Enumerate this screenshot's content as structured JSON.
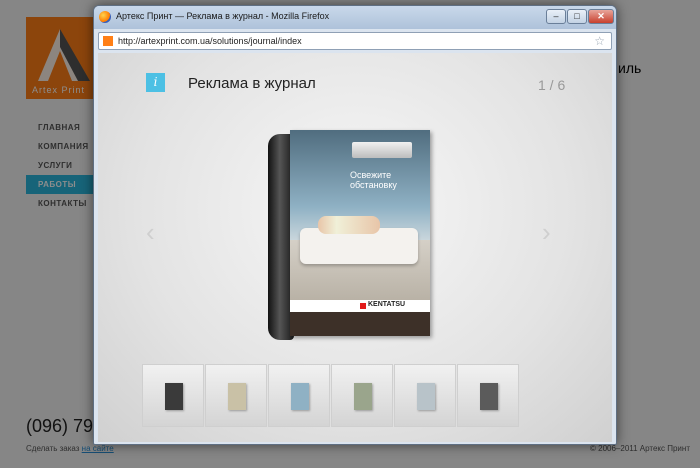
{
  "background_page": {
    "logo_text": "Artex Print",
    "heading_tail": "иль",
    "nav": [
      {
        "label": "ГЛАВНАЯ",
        "active": false
      },
      {
        "label": "КОМПАНИЯ",
        "active": false
      },
      {
        "label": "УСЛУГИ",
        "active": false
      },
      {
        "label": "РАБОТЫ",
        "active": true
      },
      {
        "label": "КОНТАКТЫ",
        "active": false
      }
    ],
    "phone": "(096) 79",
    "order_prefix": "Сделать заказ ",
    "order_link": "на сайте",
    "copyright": "© 2006–2011 Артекс Принт"
  },
  "browser": {
    "title": "Артекс Принт — Реклама в журнал - Mozilla Firefox",
    "url": "http://artexprint.com.ua/solutions/journal/index",
    "min_glyph": "–",
    "max_glyph": "□",
    "close_glyph": "✕",
    "star_glyph": "☆"
  },
  "gallery": {
    "info_glyph": "i",
    "title": "Реклама в журнал",
    "counter": "1 / 6",
    "prev_glyph": "‹",
    "next_glyph": "›",
    "ad_headline_1": "Освежите",
    "ad_headline_2": "обстановку",
    "ad_brand": "KENTATSU",
    "thumb_colors": [
      "#3a3a3a",
      "#c9c1a6",
      "#8fb1c4",
      "#9aa58c",
      "#b8c3c9",
      "#5b5b5b"
    ]
  },
  "colors": {
    "accent": "#2bb7dc",
    "logo_orange": "#ff7f16",
    "info_blue": "#4cc0e4"
  }
}
